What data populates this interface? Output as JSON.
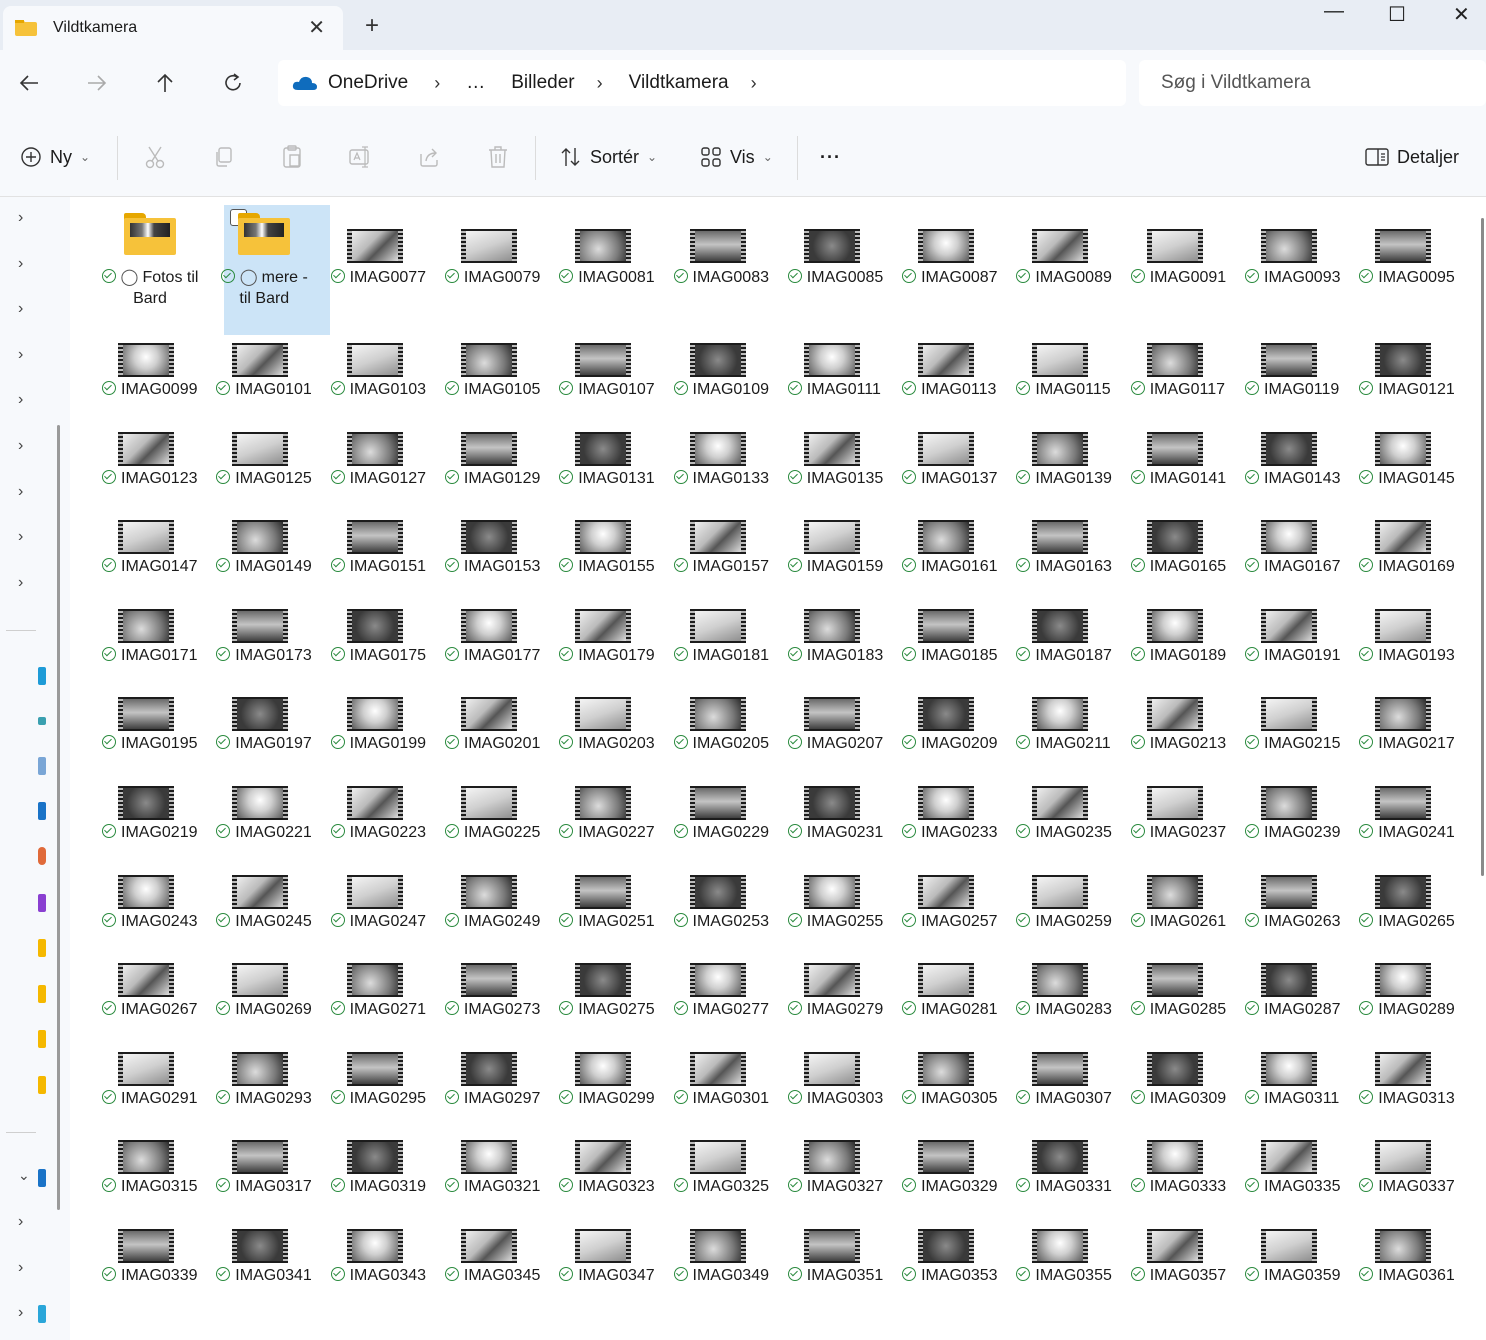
{
  "window": {
    "tab_title": "Vildtkamera",
    "tab_close": "✕",
    "new_tab": "+",
    "minimize": "—",
    "maximize": "☐",
    "close": "✕"
  },
  "address_bar": {
    "crumbs": [
      "OneDrive",
      "…",
      "Billeder",
      "Vildtkamera"
    ],
    "separator": "›",
    "search_placeholder": "Søg i Vildtkamera"
  },
  "command_bar": {
    "new_label": "Ny",
    "sort_label": "Sortér",
    "view_label": "Vis",
    "more_label": "···",
    "details_label": "Detaljer"
  },
  "colors": {
    "accent_selection": "#cce4f7",
    "sync_check": "#2a8a3e",
    "folder": "#f6c23a",
    "onedrive": "#0f6cbd"
  },
  "items": [
    {
      "type": "folder",
      "name": "Fotos til Bard",
      "shared": true,
      "selected": false
    },
    {
      "type": "folder",
      "name": "mere - til Bard",
      "shared": true,
      "selected": true
    },
    {
      "type": "video",
      "name": "IMAG0077"
    },
    {
      "type": "video",
      "name": "IMAG0079"
    },
    {
      "type": "video",
      "name": "IMAG0081"
    },
    {
      "type": "video",
      "name": "IMAG0083"
    },
    {
      "type": "video",
      "name": "IMAG0085"
    },
    {
      "type": "video",
      "name": "IMAG0087"
    },
    {
      "type": "video",
      "name": "IMAG0089"
    },
    {
      "type": "video",
      "name": "IMAG0091"
    },
    {
      "type": "video",
      "name": "IMAG0093"
    },
    {
      "type": "video",
      "name": "IMAG0095"
    },
    {
      "type": "video",
      "name": "IMAG0099"
    },
    {
      "type": "video",
      "name": "IMAG0101"
    },
    {
      "type": "video",
      "name": "IMAG0103"
    },
    {
      "type": "video",
      "name": "IMAG0105"
    },
    {
      "type": "video",
      "name": "IMAG0107"
    },
    {
      "type": "video",
      "name": "IMAG0109"
    },
    {
      "type": "video",
      "name": "IMAG0111"
    },
    {
      "type": "video",
      "name": "IMAG0113"
    },
    {
      "type": "video",
      "name": "IMAG0115"
    },
    {
      "type": "video",
      "name": "IMAG0117"
    },
    {
      "type": "video",
      "name": "IMAG0119"
    },
    {
      "type": "video",
      "name": "IMAG0121"
    },
    {
      "type": "video",
      "name": "IMAG0123"
    },
    {
      "type": "video",
      "name": "IMAG0125"
    },
    {
      "type": "video",
      "name": "IMAG0127"
    },
    {
      "type": "video",
      "name": "IMAG0129"
    },
    {
      "type": "video",
      "name": "IMAG0131"
    },
    {
      "type": "video",
      "name": "IMAG0133"
    },
    {
      "type": "video",
      "name": "IMAG0135"
    },
    {
      "type": "video",
      "name": "IMAG0137"
    },
    {
      "type": "video",
      "name": "IMAG0139"
    },
    {
      "type": "video",
      "name": "IMAG0141"
    },
    {
      "type": "video",
      "name": "IMAG0143"
    },
    {
      "type": "video",
      "name": "IMAG0145"
    },
    {
      "type": "video",
      "name": "IMAG0147"
    },
    {
      "type": "video",
      "name": "IMAG0149"
    },
    {
      "type": "video",
      "name": "IMAG0151"
    },
    {
      "type": "video",
      "name": "IMAG0153"
    },
    {
      "type": "video",
      "name": "IMAG0155"
    },
    {
      "type": "video",
      "name": "IMAG0157"
    },
    {
      "type": "video",
      "name": "IMAG0159"
    },
    {
      "type": "video",
      "name": "IMAG0161"
    },
    {
      "type": "video",
      "name": "IMAG0163"
    },
    {
      "type": "video",
      "name": "IMAG0165"
    },
    {
      "type": "video",
      "name": "IMAG0167"
    },
    {
      "type": "video",
      "name": "IMAG0169"
    },
    {
      "type": "video",
      "name": "IMAG0171"
    },
    {
      "type": "video",
      "name": "IMAG0173"
    },
    {
      "type": "video",
      "name": "IMAG0175"
    },
    {
      "type": "video",
      "name": "IMAG0177"
    },
    {
      "type": "video",
      "name": "IMAG0179"
    },
    {
      "type": "video",
      "name": "IMAG0181"
    },
    {
      "type": "video",
      "name": "IMAG0183"
    },
    {
      "type": "video",
      "name": "IMAG0185"
    },
    {
      "type": "video",
      "name": "IMAG0187"
    },
    {
      "type": "video",
      "name": "IMAG0189"
    },
    {
      "type": "video",
      "name": "IMAG0191"
    },
    {
      "type": "video",
      "name": "IMAG0193"
    },
    {
      "type": "video",
      "name": "IMAG0195"
    },
    {
      "type": "video",
      "name": "IMAG0197"
    },
    {
      "type": "video",
      "name": "IMAG0199"
    },
    {
      "type": "video",
      "name": "IMAG0201"
    },
    {
      "type": "video",
      "name": "IMAG0203"
    },
    {
      "type": "video",
      "name": "IMAG0205"
    },
    {
      "type": "video",
      "name": "IMAG0207"
    },
    {
      "type": "video",
      "name": "IMAG0209"
    },
    {
      "type": "video",
      "name": "IMAG0211"
    },
    {
      "type": "video",
      "name": "IMAG0213"
    },
    {
      "type": "video",
      "name": "IMAG0215"
    },
    {
      "type": "video",
      "name": "IMAG0217"
    },
    {
      "type": "video",
      "name": "IMAG0219"
    },
    {
      "type": "video",
      "name": "IMAG0221"
    },
    {
      "type": "video",
      "name": "IMAG0223"
    },
    {
      "type": "video",
      "name": "IMAG0225"
    },
    {
      "type": "video",
      "name": "IMAG0227"
    },
    {
      "type": "video",
      "name": "IMAG0229"
    },
    {
      "type": "video",
      "name": "IMAG0231"
    },
    {
      "type": "video",
      "name": "IMAG0233"
    },
    {
      "type": "video",
      "name": "IMAG0235"
    },
    {
      "type": "video",
      "name": "IMAG0237"
    },
    {
      "type": "video",
      "name": "IMAG0239"
    },
    {
      "type": "video",
      "name": "IMAG0241"
    },
    {
      "type": "video",
      "name": "IMAG0243"
    },
    {
      "type": "video",
      "name": "IMAG0245"
    },
    {
      "type": "video",
      "name": "IMAG0247"
    },
    {
      "type": "video",
      "name": "IMAG0249"
    },
    {
      "type": "video",
      "name": "IMAG0251"
    },
    {
      "type": "video",
      "name": "IMAG0253"
    },
    {
      "type": "video",
      "name": "IMAG0255"
    },
    {
      "type": "video",
      "name": "IMAG0257"
    },
    {
      "type": "video",
      "name": "IMAG0259"
    },
    {
      "type": "video",
      "name": "IMAG0261"
    },
    {
      "type": "video",
      "name": "IMAG0263"
    },
    {
      "type": "video",
      "name": "IMAG0265"
    },
    {
      "type": "video",
      "name": "IMAG0267"
    },
    {
      "type": "video",
      "name": "IMAG0269"
    },
    {
      "type": "video",
      "name": "IMAG0271"
    },
    {
      "type": "video",
      "name": "IMAG0273"
    },
    {
      "type": "video",
      "name": "IMAG0275"
    },
    {
      "type": "video",
      "name": "IMAG0277"
    },
    {
      "type": "video",
      "name": "IMAG0279"
    },
    {
      "type": "video",
      "name": "IMAG0281"
    },
    {
      "type": "video",
      "name": "IMAG0283"
    },
    {
      "type": "video",
      "name": "IMAG0285"
    },
    {
      "type": "video",
      "name": "IMAG0287"
    },
    {
      "type": "video",
      "name": "IMAG0289"
    },
    {
      "type": "video",
      "name": "IMAG0291"
    },
    {
      "type": "video",
      "name": "IMAG0293"
    },
    {
      "type": "video",
      "name": "IMAG0295"
    },
    {
      "type": "video",
      "name": "IMAG0297"
    },
    {
      "type": "video",
      "name": "IMAG0299"
    },
    {
      "type": "video",
      "name": "IMAG0301"
    },
    {
      "type": "video",
      "name": "IMAG0303"
    },
    {
      "type": "video",
      "name": "IMAG0305"
    },
    {
      "type": "video",
      "name": "IMAG0307"
    },
    {
      "type": "video",
      "name": "IMAG0309"
    },
    {
      "type": "video",
      "name": "IMAG0311"
    },
    {
      "type": "video",
      "name": "IMAG0313"
    },
    {
      "type": "video",
      "name": "IMAG0315"
    },
    {
      "type": "video",
      "name": "IMAG0317"
    },
    {
      "type": "video",
      "name": "IMAG0319"
    },
    {
      "type": "video",
      "name": "IMAG0321"
    },
    {
      "type": "video",
      "name": "IMAG0323"
    },
    {
      "type": "video",
      "name": "IMAG0325"
    },
    {
      "type": "video",
      "name": "IMAG0327"
    },
    {
      "type": "video",
      "name": "IMAG0329"
    },
    {
      "type": "video",
      "name": "IMAG0331"
    },
    {
      "type": "video",
      "name": "IMAG0333"
    },
    {
      "type": "video",
      "name": "IMAG0335"
    },
    {
      "type": "video",
      "name": "IMAG0337"
    },
    {
      "type": "video",
      "name": "IMAG0339"
    },
    {
      "type": "video",
      "name": "IMAG0341"
    },
    {
      "type": "video",
      "name": "IMAG0343"
    },
    {
      "type": "video",
      "name": "IMAG0345"
    },
    {
      "type": "video",
      "name": "IMAG0347"
    },
    {
      "type": "video",
      "name": "IMAG0349"
    },
    {
      "type": "video",
      "name": "IMAG0351"
    },
    {
      "type": "video",
      "name": "IMAG0353"
    },
    {
      "type": "video",
      "name": "IMAG0355"
    },
    {
      "type": "video",
      "name": "IMAG0357"
    },
    {
      "type": "video",
      "name": "IMAG0359"
    },
    {
      "type": "video",
      "name": "IMAG0361"
    }
  ]
}
